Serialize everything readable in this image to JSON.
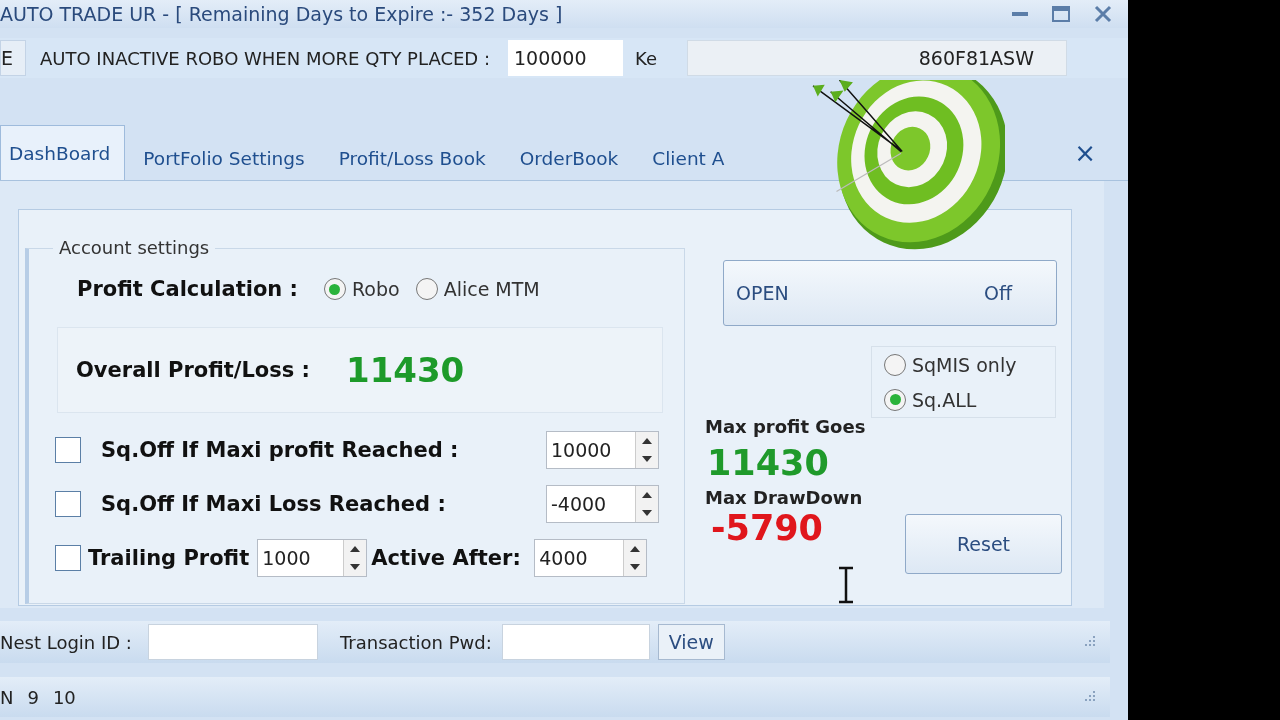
{
  "window": {
    "title": "AUTO TRADE UR - [ Remaining Days to Expire  :-  352  Days ]"
  },
  "toolbar": {
    "left_button": "E",
    "qty_label": "AUTO INACTIVE ROBO WHEN MORE QTY PLACED :",
    "qty_value": "100000",
    "key_label": "Ke",
    "key_value": "860F81ASW"
  },
  "tabs": [
    {
      "label": "DashBoard",
      "selected": true
    },
    {
      "label": "PortFolio Settings",
      "selected": false
    },
    {
      "label": "Profit/Loss Book",
      "selected": false
    },
    {
      "label": "OrderBook",
      "selected": false
    },
    {
      "label": "Client A",
      "selected": false
    }
  ],
  "tabs_close": "×",
  "account_settings": {
    "title": "Account settings",
    "profit_calculation_label": "Profit Calculation  :",
    "options": [
      {
        "label": "Robo",
        "selected": true
      },
      {
        "label": "Alice MTM",
        "selected": false
      }
    ],
    "overall_label": "Overall Profit/Loss  :",
    "overall_value": "11430",
    "rules": [
      {
        "checked": false,
        "label": "Sq.Off If Maxi profit Reached :",
        "value": "10000"
      },
      {
        "checked": false,
        "label": "Sq.Off If Maxi Loss Reached :",
        "value": "-4000"
      }
    ],
    "trailing": {
      "checked": false,
      "label": "Trailing Profit",
      "value": "1000",
      "active_label": "Active After:",
      "active_value": "4000"
    }
  },
  "open_button": {
    "left_text": "OPEN",
    "right_text": "Off"
  },
  "square_off_options": [
    {
      "label": "SqMIS only",
      "selected": false
    },
    {
      "label": "Sq.ALL",
      "selected": true
    }
  ],
  "max_profit": {
    "label": "Max profit Goes",
    "value": "11430"
  },
  "max_drawdown": {
    "label": "Max DrawDown",
    "value": "-5790"
  },
  "reset_button": "Reset",
  "login": {
    "nest_label": "Nest Login ID :",
    "pwd_label": "Transaction Pwd:",
    "view_button": "View"
  },
  "status_bar": [
    "N",
    "9",
    "10"
  ]
}
